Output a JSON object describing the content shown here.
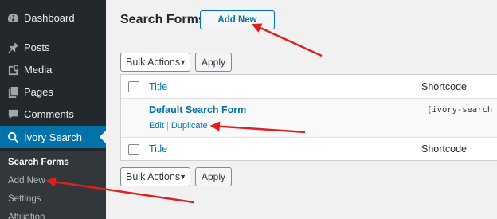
{
  "sidebar": {
    "items": [
      {
        "label": "Dashboard",
        "icon": "dashboard-icon"
      },
      {
        "label": "Posts",
        "icon": "pin-icon"
      },
      {
        "label": "Media",
        "icon": "media-icon"
      },
      {
        "label": "Pages",
        "icon": "pages-icon"
      },
      {
        "label": "Comments",
        "icon": "comment-icon"
      },
      {
        "label": "Ivory Search",
        "icon": "search-icon",
        "active": true
      }
    ],
    "submenu": [
      {
        "label": "Search Forms",
        "current": true
      },
      {
        "label": "Add New"
      },
      {
        "label": "Settings"
      },
      {
        "label": "Affiliation"
      }
    ]
  },
  "main": {
    "title": "Search Forms",
    "add_new": "Add New",
    "bulk_top": {
      "label": "Bulk Actions",
      "apply": "Apply"
    },
    "bulk_bottom": {
      "label": "Bulk Actions",
      "apply": "Apply"
    },
    "table": {
      "col_title": "Title",
      "col_shortcode": "Shortcode",
      "rows": [
        {
          "title": "Default Search Form",
          "shortcode": "[ivory-search i",
          "actions": [
            "Edit",
            "Duplicate"
          ]
        }
      ]
    }
  },
  "colors": {
    "accent": "#0073aa",
    "sidebar_bg": "#23282d",
    "arrow": "#e02020"
  }
}
